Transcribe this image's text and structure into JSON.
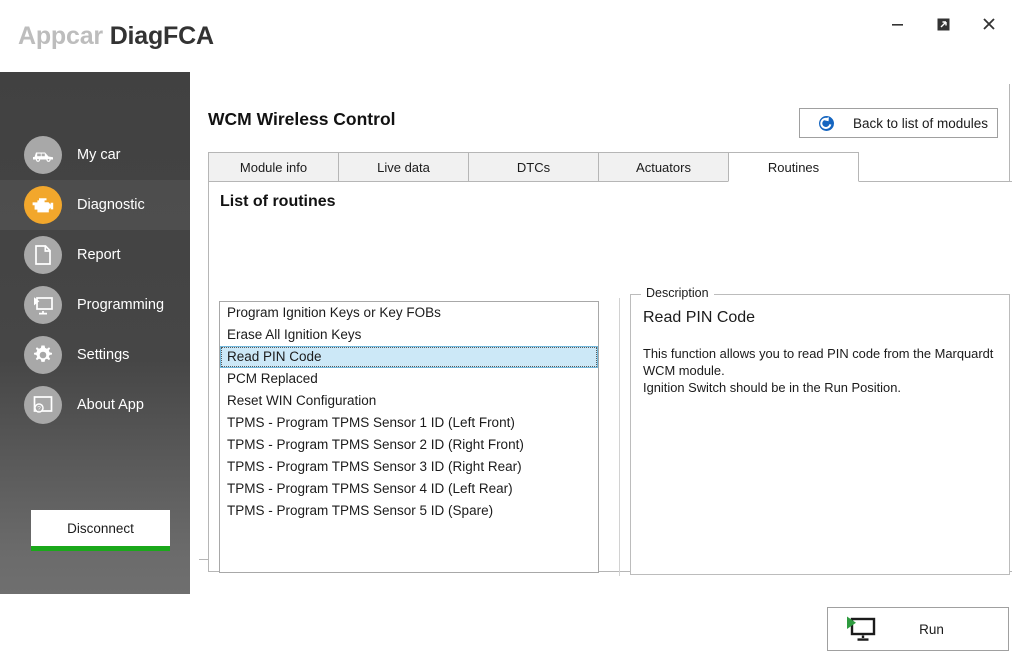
{
  "window": {
    "title_light": "Appcar",
    "title_bold": "DiagFCA",
    "controls": [
      {
        "name": "minimize",
        "glyph": "–"
      },
      {
        "name": "restore",
        "glyph": "❐"
      },
      {
        "name": "close",
        "glyph": "✕"
      }
    ]
  },
  "sidebar": {
    "items": [
      {
        "label": "My car",
        "icon": "car-icon",
        "active": false
      },
      {
        "label": "Diagnostic",
        "icon": "engine-icon",
        "active": true
      },
      {
        "label": "Report",
        "icon": "document-icon",
        "active": false
      },
      {
        "label": "Programming",
        "icon": "monitor-play-icon",
        "active": false
      },
      {
        "label": "Settings",
        "icon": "gear-icon",
        "active": false
      },
      {
        "label": "About App",
        "icon": "help-window-icon",
        "active": false
      }
    ],
    "disconnect_label": "Disconnect",
    "accent_green": "#1aa81a",
    "active_orange": "#f2a72c"
  },
  "main": {
    "panel_title": "WCM Wireless Control",
    "back_button": {
      "label": "Back to list of modules",
      "icon": "back-arrow-circle-icon",
      "color": "#1565c0"
    },
    "tabs": [
      {
        "label": "Module info",
        "active": false
      },
      {
        "label": "Live data",
        "active": false
      },
      {
        "label": "DTCs",
        "active": false
      },
      {
        "label": "Actuators",
        "active": false
      },
      {
        "label": "Routines",
        "active": true
      }
    ],
    "section_title": "List of routines",
    "routines": [
      {
        "label": "Program Ignition Keys or Key FOBs",
        "selected": false
      },
      {
        "label": "Erase All Ignition Keys",
        "selected": false
      },
      {
        "label": "Read PIN Code",
        "selected": true
      },
      {
        "label": "PCM Replaced",
        "selected": false
      },
      {
        "label": "Reset WIN Configuration",
        "selected": false
      },
      {
        "label": "TPMS - Program TPMS Sensor 1 ID (Left Front)",
        "selected": false
      },
      {
        "label": "TPMS - Program TPMS Sensor 2 ID (Right Front)",
        "selected": false
      },
      {
        "label": "TPMS - Program TPMS Sensor 3 ID (Right Rear)",
        "selected": false
      },
      {
        "label": "TPMS - Program TPMS Sensor 4 ID (Left Rear)",
        "selected": false
      },
      {
        "label": "TPMS - Program TPMS Sensor 5 ID (Spare)",
        "selected": false
      }
    ],
    "description": {
      "legend": "Description",
      "heading": "Read PIN Code",
      "text": "This function allows you to read PIN code from the Marquardt WCM module.\nIgnition Switch should be in the Run Position."
    },
    "run_button": {
      "label": "Run",
      "icon": "monitor-play-icon"
    }
  }
}
